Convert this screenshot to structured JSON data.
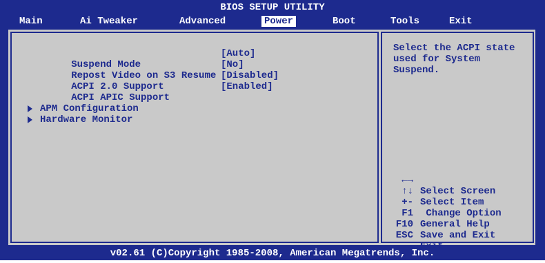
{
  "title": "BIOS SETUP UTILITY",
  "menu": [
    {
      "label": "Main",
      "active": false
    },
    {
      "label": "Ai Tweaker",
      "active": false
    },
    {
      "label": "Advanced",
      "active": false
    },
    {
      "label": "Power",
      "active": true
    },
    {
      "label": "Boot",
      "active": false
    },
    {
      "label": "Tools",
      "active": false
    },
    {
      "label": "Exit",
      "active": false
    }
  ],
  "settings": [
    {
      "label": "Suspend Mode",
      "value": "[Auto]"
    },
    {
      "label": "Repost Video on S3 Resume",
      "value": "[No]"
    },
    {
      "label": "ACPI 2.0 Support",
      "value": "[Disabled]"
    },
    {
      "label": "ACPI APIC Support",
      "value": "[Enabled]"
    }
  ],
  "submenus": [
    {
      "label": "APM Configuration"
    },
    {
      "label": "Hardware Monitor"
    }
  ],
  "help": {
    "line1": "Select the ACPI state",
    "line2": "used for System",
    "line3": "Suspend."
  },
  "keys": [
    {
      "key": "←→",
      "desc": "Select Screen"
    },
    {
      "key": "↑↓",
      "desc": "Select Item"
    },
    {
      "key": "+-",
      "desc": " Change Option"
    },
    {
      "key": "F1",
      "desc": "General Help"
    },
    {
      "key": "F10",
      "desc": "Save and Exit"
    },
    {
      "key": "ESC",
      "desc": "Exit"
    }
  ],
  "footer": "v02.61 (C)Copyright 1985-2008, American Megatrends, Inc.",
  "colors": {
    "background": "#1d2a8e",
    "panel": "#c9c9c9",
    "text_on_panel": "#1d2a8e",
    "header_text": "#ffffff"
  }
}
